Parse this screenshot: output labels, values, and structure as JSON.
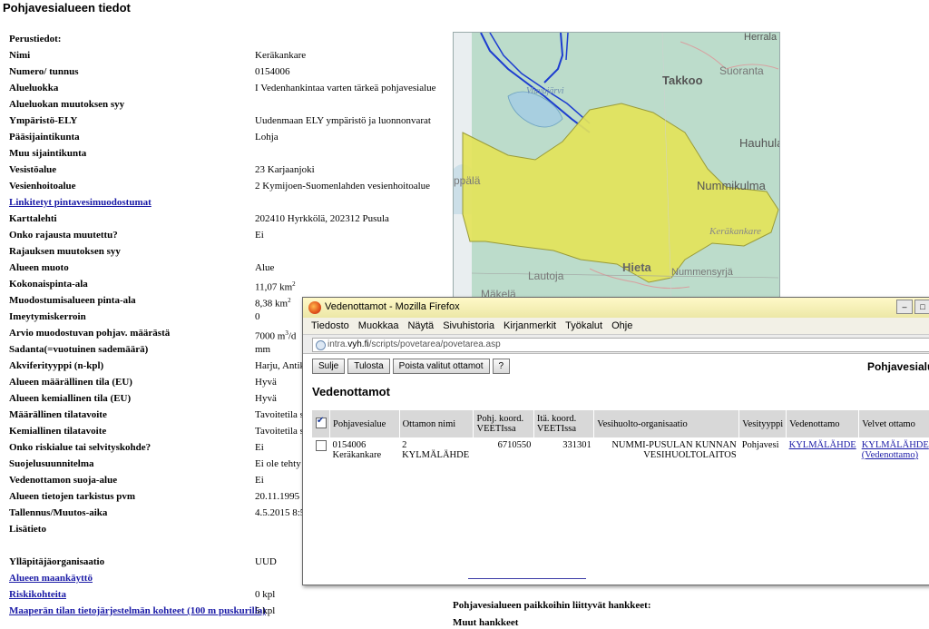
{
  "page_title": "Pohjavesialueen tiedot",
  "properties": [
    {
      "label": "Perustiedot:",
      "value": "",
      "link": false
    },
    {
      "label": "Nimi",
      "value": "Keräkankare",
      "link": false
    },
    {
      "label": "Numero/ tunnus",
      "value": "0154006",
      "link": false
    },
    {
      "label": "Alueluokka",
      "value": "I Vedenhankintaa varten tärkeä pohjavesialue",
      "link": false
    },
    {
      "label": "Alueluokan muutoksen syy",
      "value": "",
      "link": false
    },
    {
      "label": "Ympäristö-ELY",
      "value": "Uudenmaan ELY ympäristö ja luonnonvarat",
      "link": false
    },
    {
      "label": "Pääsijaintikunta",
      "value": "Lohja",
      "link": false
    },
    {
      "label": "Muu sijaintikunta",
      "value": "",
      "link": false
    },
    {
      "label": "Vesistöalue",
      "value": "23 Karjaanjoki",
      "link": false
    },
    {
      "label": "Vesienhoitoalue",
      "value": "2 Kymijoen-Suomenlahden vesienhoitoalue",
      "link": false
    },
    {
      "label": "Linkitetyt pintavesimuodostumat",
      "value": "",
      "link": true
    },
    {
      "label": "Karttalehti",
      "value": "202410 Hyrkkölä, 202312 Pusula",
      "link": false
    },
    {
      "label": "Onko rajausta muutettu?",
      "value": "Ei",
      "link": false
    },
    {
      "label": "Rajauksen muutoksen syy",
      "value": "",
      "link": false
    },
    {
      "label": "Alueen muoto",
      "value": "Alue",
      "link": false
    },
    {
      "label": "Kokonaispinta-ala",
      "value": "11,07 km",
      "sup": "2",
      "link": false
    },
    {
      "label": "Muodostumisalueen pinta-ala",
      "value": "8,38 km",
      "sup": "2",
      "link": false
    },
    {
      "label": "Imeytymiskerroin",
      "value": "0",
      "link": false
    },
    {
      "label": "Arvio muodostuvan pohjav. määrästä",
      "value": "7000 m",
      "sup": "3",
      "suffix": "/d",
      "link": false
    },
    {
      "label": "Sadanta(=vuotuinen sademäärä)",
      "value": "mm",
      "link": false
    },
    {
      "label": "Akviferityyppi (n-kpl)",
      "value": "Harju, Antik",
      "link": false
    },
    {
      "label": "Alueen määrällinen tila (EU)",
      "value": "Hyvä",
      "link": false
    },
    {
      "label": "Alueen kemiallinen tila (EU)",
      "value": "Hyvä",
      "link": false
    },
    {
      "label": "Määrällinen tilatavoite",
      "value": "Tavoitetila s",
      "link": false
    },
    {
      "label": "Kemiallinen tilatavoite",
      "value": "Tavoitetila s",
      "link": false
    },
    {
      "label": "Onko riskialue tai selvityskohde?",
      "value": "Ei",
      "link": false
    },
    {
      "label": "Suojelusuunnitelma",
      "value": "Ei ole tehty",
      "link": false
    },
    {
      "label": "Vedenottamon suoja-alue",
      "value": "Ei",
      "link": false
    },
    {
      "label": "Alueen tietojen tarkistus pvm",
      "value": "20.11.1995",
      "link": false
    },
    {
      "label": "Tallennus/Muutos-aika",
      "value": "4.5.2015 8:5",
      "link": false
    },
    {
      "label": "Lisätieto",
      "value": "",
      "link": false
    },
    {
      "label": "",
      "value": "",
      "link": false
    },
    {
      "label": "Ylläpitäjäorganisaatio",
      "value": "UUD",
      "link": false
    },
    {
      "label": "Alueen maankäyttö",
      "value": "",
      "link": true
    },
    {
      "label": "Riskikohteita",
      "value": "0 kpl",
      "link": true
    },
    {
      "label": "Maaperän tilan tietojärjestelmän kohteet (100 m puskurilla)",
      "value": "5 kpl",
      "link": true
    }
  ],
  "map_labels": {
    "herrala": "Herrala",
    "takkoo": "Takkoo",
    "suoranta": "Suoranta",
    "viuvajarvi": "Viuvajärvi",
    "hauhula": "Hauhula",
    "nummikulma": "Nummikulma",
    "ppala": "ppälä",
    "kerakankare": "Keräkankare",
    "lautoja": "Lautoja",
    "hieta": "Hieta",
    "nummensyrja": "Nummensyrjä",
    "makela": "Mäkelä"
  },
  "bottom": {
    "hankkeet": "Pohjavesialueen paikkoihin liittyvät hankkeet:",
    "muut": "Muut hankkeet"
  },
  "firefox": {
    "title": "Vedenottamot - Mozilla Firefox",
    "menu": [
      "Tiedosto",
      "Muokkaa",
      "Näytä",
      "Sivuhistoria",
      "Kirjanmerkit",
      "Työkalut",
      "Ohje"
    ],
    "url_domain": "intra.vyh.fi",
    "url_prefix": "intra.",
    "url_host": "vyh.fi",
    "url_path": "/scripts/povetarea/povetarea.asp",
    "buttons": [
      "Sulje",
      "Tulosta",
      "Poista valitut ottamot",
      "?"
    ],
    "right_title": "Pohjavesialue",
    "heading": "Vedenottamot",
    "columns": [
      "Pohjavesialue",
      "Ottamon nimi",
      "Pohj. koord. VEETIssa",
      "Itä. koord. VEETIssa",
      "Vesihuolto-organisaatio",
      "Vesityyppi",
      "Vedenottamo",
      "Velvet ottamo"
    ],
    "rows": [
      {
        "area_num": "0154006",
        "area_name": "Keräkankare",
        "intake_num": "2",
        "intake_name": "KYLMÄLÄHDE",
        "north": "6710550",
        "east": "331301",
        "org_line1": "NUMMI-PUSULAN KUNNAN",
        "org_line2": "VESIHUOLTOLAITOS",
        "water_type": "Pohjavesi",
        "intake_link": "KYLMÄLÄHDE",
        "velvet_link": "KYLMÄLÄHDE",
        "velvet_sub": "(Vedenottamo)"
      }
    ]
  }
}
